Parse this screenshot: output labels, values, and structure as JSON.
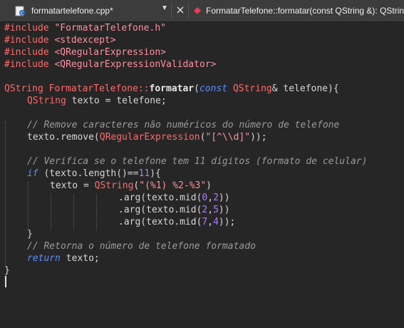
{
  "tabs": {
    "file_tab_title": "formatartelefone.cpp*",
    "dropdown_glyph": "▼",
    "symbol_title": "FormatarTelefone::formatar(const QString &): QString"
  },
  "code": {
    "l1a": "#include ",
    "l1b": "\"FormatarTelefone.h\"",
    "l2a": "#include ",
    "l2b": "<stdexcept>",
    "l3a": "#include ",
    "l3b": "<QRegularExpression>",
    "l4a": "#include ",
    "l4b": "<QRegularExpressionValidator>",
    "l6_type": "QString",
    "l6_cls": " FormatarTelefone::",
    "l6_fn": "formatar",
    "l6_p1": "(",
    "l6_const": "const",
    "l6_sp": " ",
    "l6_qs": "QString",
    "l6_rest": "& telefone){",
    "l7_type": "QString",
    "l7_rest": " texto = telefone;",
    "l9_comment": "// Remove caracteres não numéricos do número de telefone",
    "l10_a": "texto.remove(",
    "l10_type": "QRegularExpression",
    "l10_b": "(",
    "l10_str": "\"[^\\\\d]\"",
    "l10_c": "));",
    "l12_comment": "// Verifica se o telefone tem 11 dígitos (formato de celular)",
    "l13_if": "if",
    "l13_a": " (texto.length()==",
    "l13_num": "11",
    "l13_b": "){",
    "l14_a": "texto = ",
    "l14_type": "QString",
    "l14_b": "(",
    "l14_str": "\"(%1) %2-%3\"",
    "l14_c": ")",
    "l15_a": ".arg(texto.mid(",
    "l15_n1": "0",
    "l15_comma": ",",
    "l15_n2": "2",
    "l15_b": "))",
    "l16_a": ".arg(texto.mid(",
    "l16_n1": "2",
    "l16_comma": ",",
    "l16_n2": "5",
    "l16_b": "))",
    "l17_a": ".arg(texto.mid(",
    "l17_n1": "7",
    "l17_comma": ",",
    "l17_n2": "4",
    "l17_b": "));",
    "l18": "}",
    "l19_comment": "// Retorna o número de telefone formatado",
    "l20_ret": "return",
    "l20_rest": " texto;",
    "l21": "}"
  }
}
